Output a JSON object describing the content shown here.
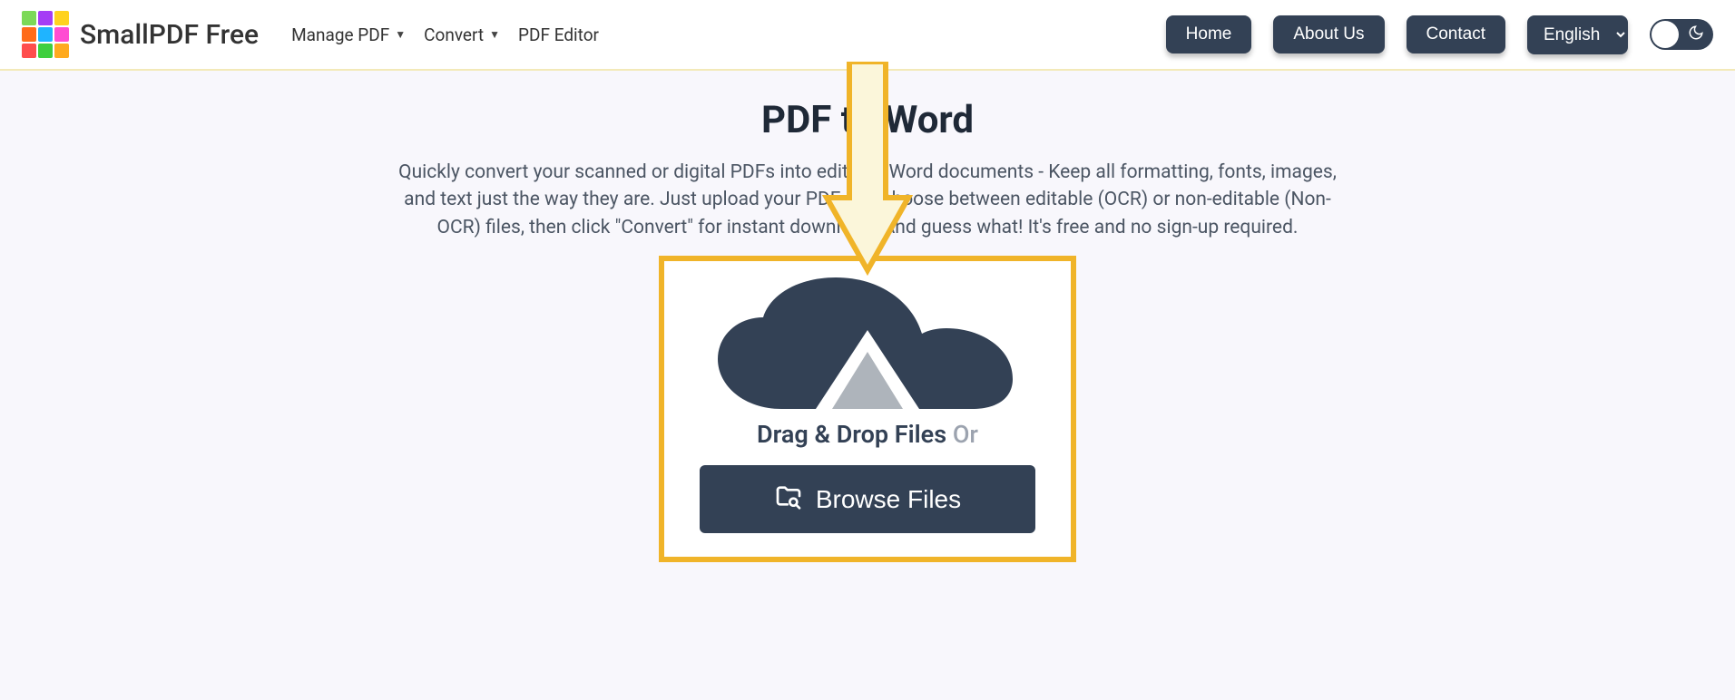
{
  "brand": "SmallPDF Free",
  "nav": {
    "manage": "Manage PDF",
    "convert": "Convert",
    "editor": "PDF Editor"
  },
  "buttons": {
    "home": "Home",
    "about": "About Us",
    "contact": "Contact"
  },
  "language": "English",
  "page": {
    "title": "PDF to Word",
    "description": "Quickly convert your scanned or digital PDFs into editable Word documents - Keep all formatting, fonts, images, and text just the way they are. Just upload your PDF and choose between editable (OCR) or non-editable (Non-OCR) files, then click \"Convert\" for instant download. And guess what! It's free and no sign-up required."
  },
  "upload": {
    "drag_label": "Drag & Drop Files",
    "or": "Or",
    "browse": "Browse Files"
  },
  "logo_colors": [
    "#7cd957",
    "#a53df5",
    "#ffd21f",
    "#ff6b1a",
    "#1fb4ff",
    "#ff4dd2",
    "#ff4d4d",
    "#3fcf3f",
    "#ffaa1f"
  ]
}
